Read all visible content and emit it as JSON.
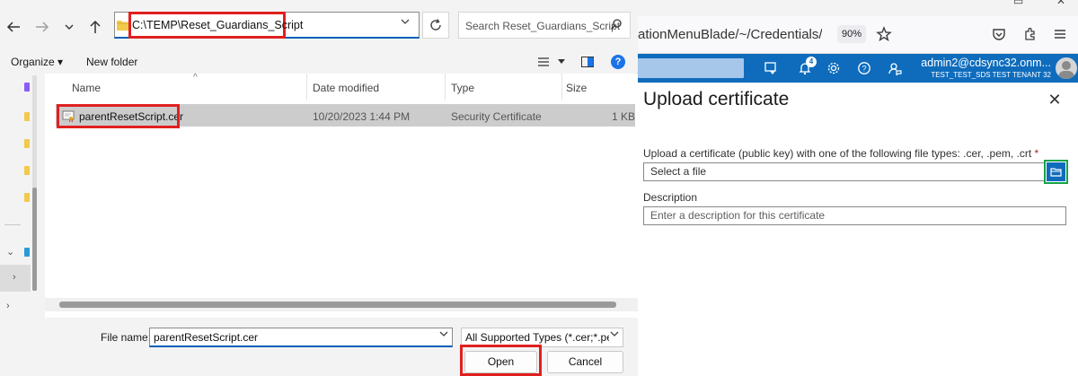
{
  "browser": {
    "url_fragment": "ationMenuBlade/~/Credentials/quick",
    "zoom": "90%",
    "account_name": "admin2@cdsync32.onm...",
    "tenant_name": "TEST_TEST_SDS TEST TENANT 32",
    "notification_count": "4"
  },
  "panel": {
    "title": "Upload certificate",
    "upload_label": "Upload a certificate (public key) with one of the following file types: .cer, .pem, .crt",
    "required_mark": "*",
    "file_placeholder": "Select a file",
    "description_label": "Description",
    "description_placeholder": "Enter a description for this certificate"
  },
  "dialog": {
    "path": "C:\\TEMP\\Reset_Guardians_Script",
    "search_placeholder": "Search Reset_Guardians_Script",
    "organize_label": "Organize",
    "new_folder_label": "New folder",
    "columns": [
      "Name",
      "Date modified",
      "Type",
      "Size"
    ],
    "files": [
      {
        "name": "parentResetScript.cer",
        "date": "10/20/2023 1:44 PM",
        "type": "Security Certificate",
        "size": "1 KB"
      }
    ],
    "file_name_label": "File name:",
    "file_name_value": "parentResetScript.cer",
    "file_type_value": "All Supported Types (*.cer;*.pem",
    "open_label": "Open",
    "cancel_label": "Cancel"
  },
  "colors": {
    "azure_blue": "#0f6cbd",
    "highlight_red": "#e0201f",
    "highlight_green": "#16a24a"
  }
}
